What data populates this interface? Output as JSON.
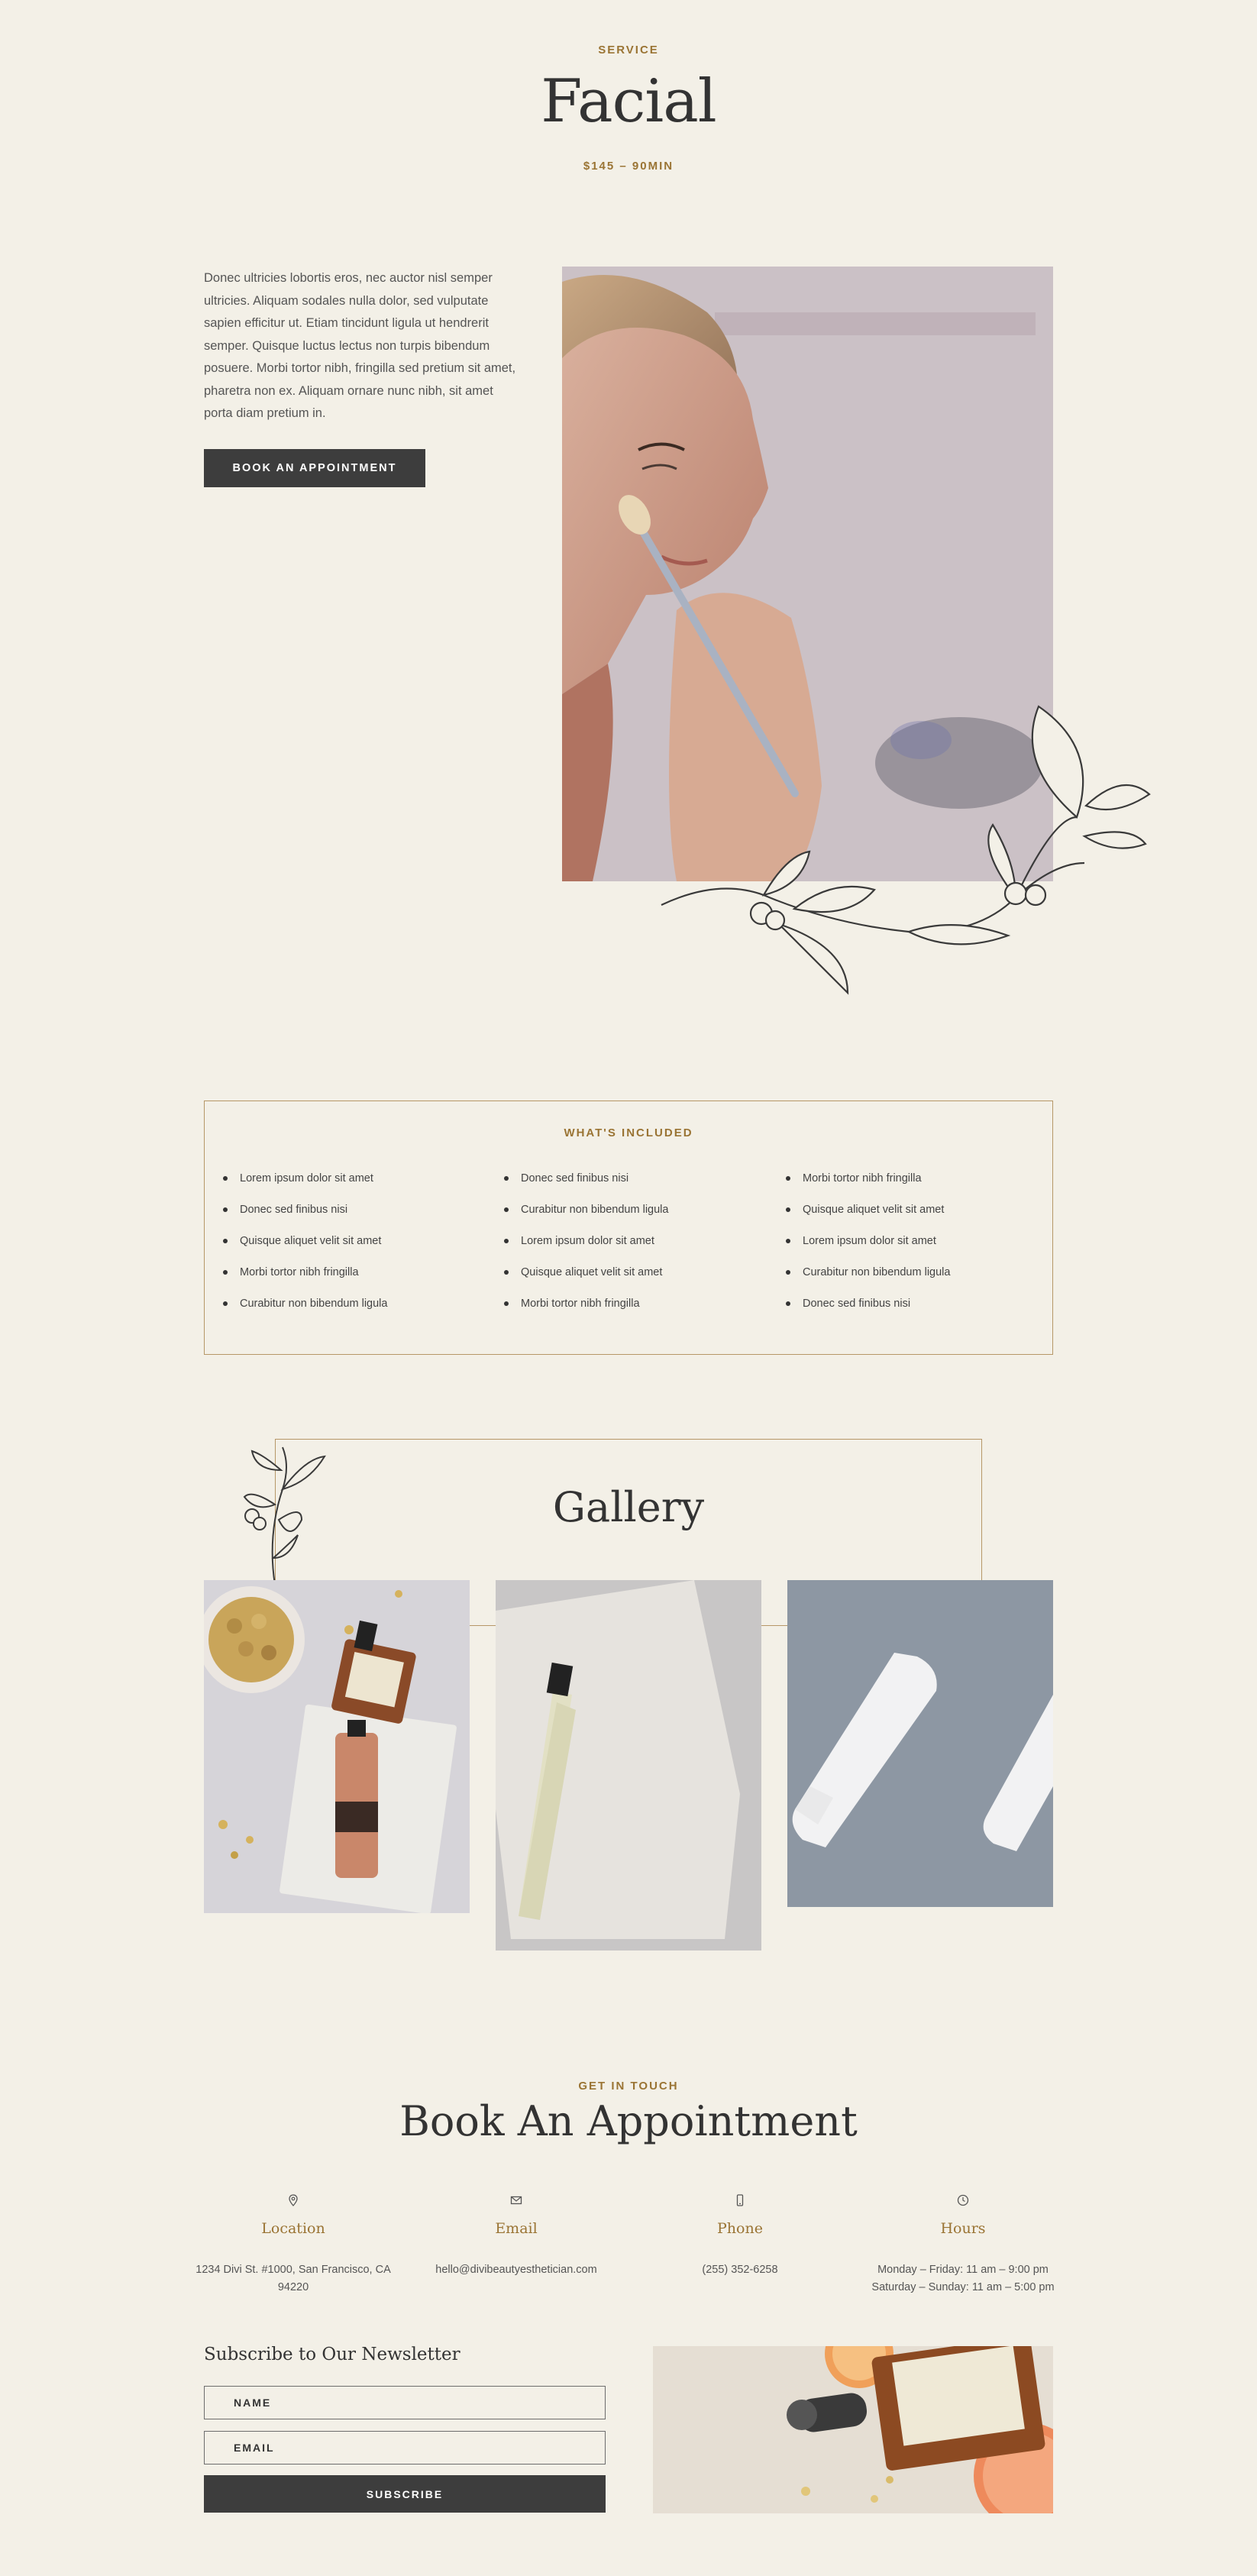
{
  "hero": {
    "eyebrow": "SERVICE",
    "title": "Facial",
    "price": "$145 – 90MIN",
    "description": "Donec ultricies lobortis eros, nec auctor nisl semper ultricies. Aliquam sodales nulla dolor, sed vulputate sapien efficitur ut. Etiam tincidunt ligula ut hendrerit semper. Quisque luctus lectus non turpis bibendum posuere. Morbi tortor nibh, fringilla sed pretium sit amet, pharetra non ex. Aliquam ornare nunc nibh, sit amet porta diam pretium in.",
    "button_label": "BOOK AN APPOINTMENT"
  },
  "included": {
    "title": "WHAT'S INCLUDED",
    "columns": [
      [
        "Lorem ipsum dolor sit amet",
        "Donec sed finibus nisi",
        "Quisque aliquet velit sit amet",
        "Morbi tortor nibh fringilla",
        "Curabitur non bibendum ligula"
      ],
      [
        "Donec sed finibus nisi",
        "Curabitur non bibendum ligula",
        "Lorem ipsum dolor sit amet",
        "Quisque aliquet velit sit amet",
        "Morbi tortor nibh fringilla"
      ],
      [
        "Morbi tortor nibh fringilla",
        "Quisque aliquet velit sit amet",
        "Lorem ipsum dolor sit amet",
        "Curabitur non bibendum ligula",
        "Donec sed finibus nisi"
      ]
    ]
  },
  "gallery": {
    "title": "Gallery"
  },
  "contact": {
    "eyebrow": "GET IN TOUCH",
    "title": "Book An Appointment",
    "items": [
      {
        "icon": "location-pin-icon",
        "label": "Location",
        "value": "1234 Divi St. #1000, San Francisco, CA 94220"
      },
      {
        "icon": "envelope-icon",
        "label": "Email",
        "value": "hello@divibeautyesthetician.com"
      },
      {
        "icon": "phone-icon",
        "label": "Phone",
        "value": "(255) 352-6258"
      },
      {
        "icon": "clock-icon",
        "label": "Hours",
        "value": "Monday – Friday: 11 am – 9:00 pm\nSaturday – Sunday: 11 am – 5:00 pm"
      }
    ]
  },
  "newsletter": {
    "title": "Subscribe to Our Newsletter",
    "name_placeholder": "NAME",
    "email_placeholder": "EMAIL",
    "submit_label": "SUBSCRIBE"
  },
  "colors": {
    "background": "#f3f0e7",
    "accent_gold": "#9a7434",
    "border_gold": "#b69767",
    "button_dark": "#3d3d3d"
  }
}
